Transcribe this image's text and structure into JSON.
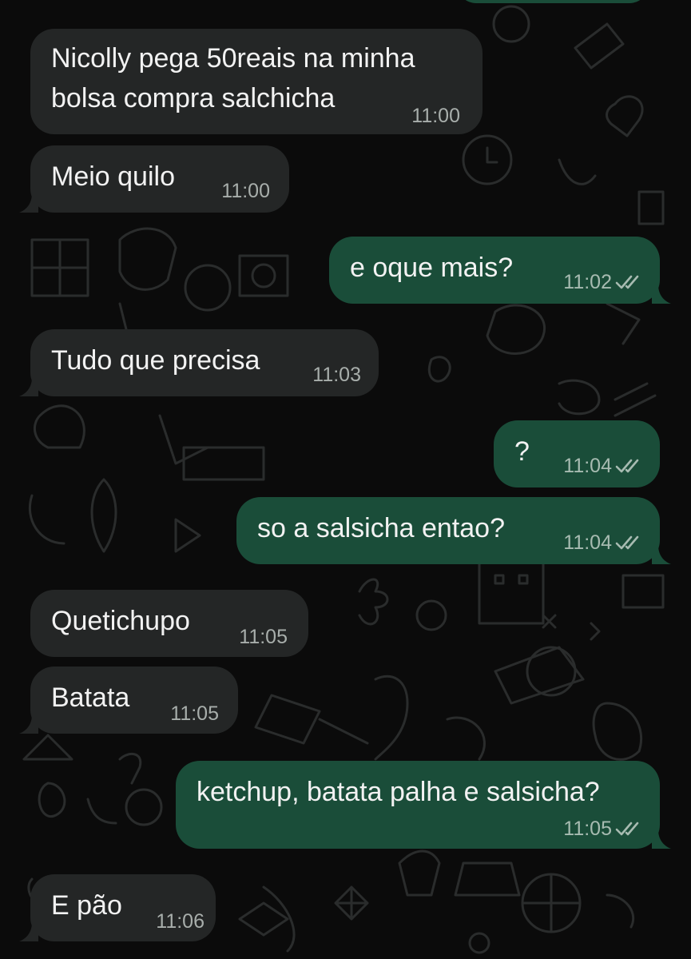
{
  "theme": {
    "background": "#0b0b0b",
    "incoming_bubble": "#242626",
    "outgoing_bubble": "#1a4d39",
    "timestamp_color": "#a8aeab",
    "read_tick_color": "#a7bbb1"
  },
  "conversation": {
    "messages": [
      {
        "direction": "incoming",
        "text_lines": [
          "Nicolly pega 50reais na minha",
          "bolsa compra salchicha"
        ],
        "time": "11:00"
      },
      {
        "direction": "incoming",
        "text": "Meio quilo",
        "time": "11:00"
      },
      {
        "direction": "outgoing",
        "text": "e oque mais?",
        "time": "11:02",
        "status": "read"
      },
      {
        "direction": "incoming",
        "text": "Tudo que precisa",
        "time": "11:03"
      },
      {
        "direction": "outgoing",
        "text": "?",
        "time": "11:04",
        "status": "read"
      },
      {
        "direction": "outgoing",
        "text": "so a salsicha entao?",
        "time": "11:04",
        "status": "read"
      },
      {
        "direction": "incoming",
        "text": "Quetichupo",
        "time": "11:05"
      },
      {
        "direction": "incoming",
        "text": "Batata",
        "time": "11:05"
      },
      {
        "direction": "outgoing",
        "text": "ketchup, batata palha e salsicha?",
        "time": "11:05",
        "status": "read"
      },
      {
        "direction": "incoming",
        "text": "E pão",
        "time": "11:06"
      }
    ]
  }
}
